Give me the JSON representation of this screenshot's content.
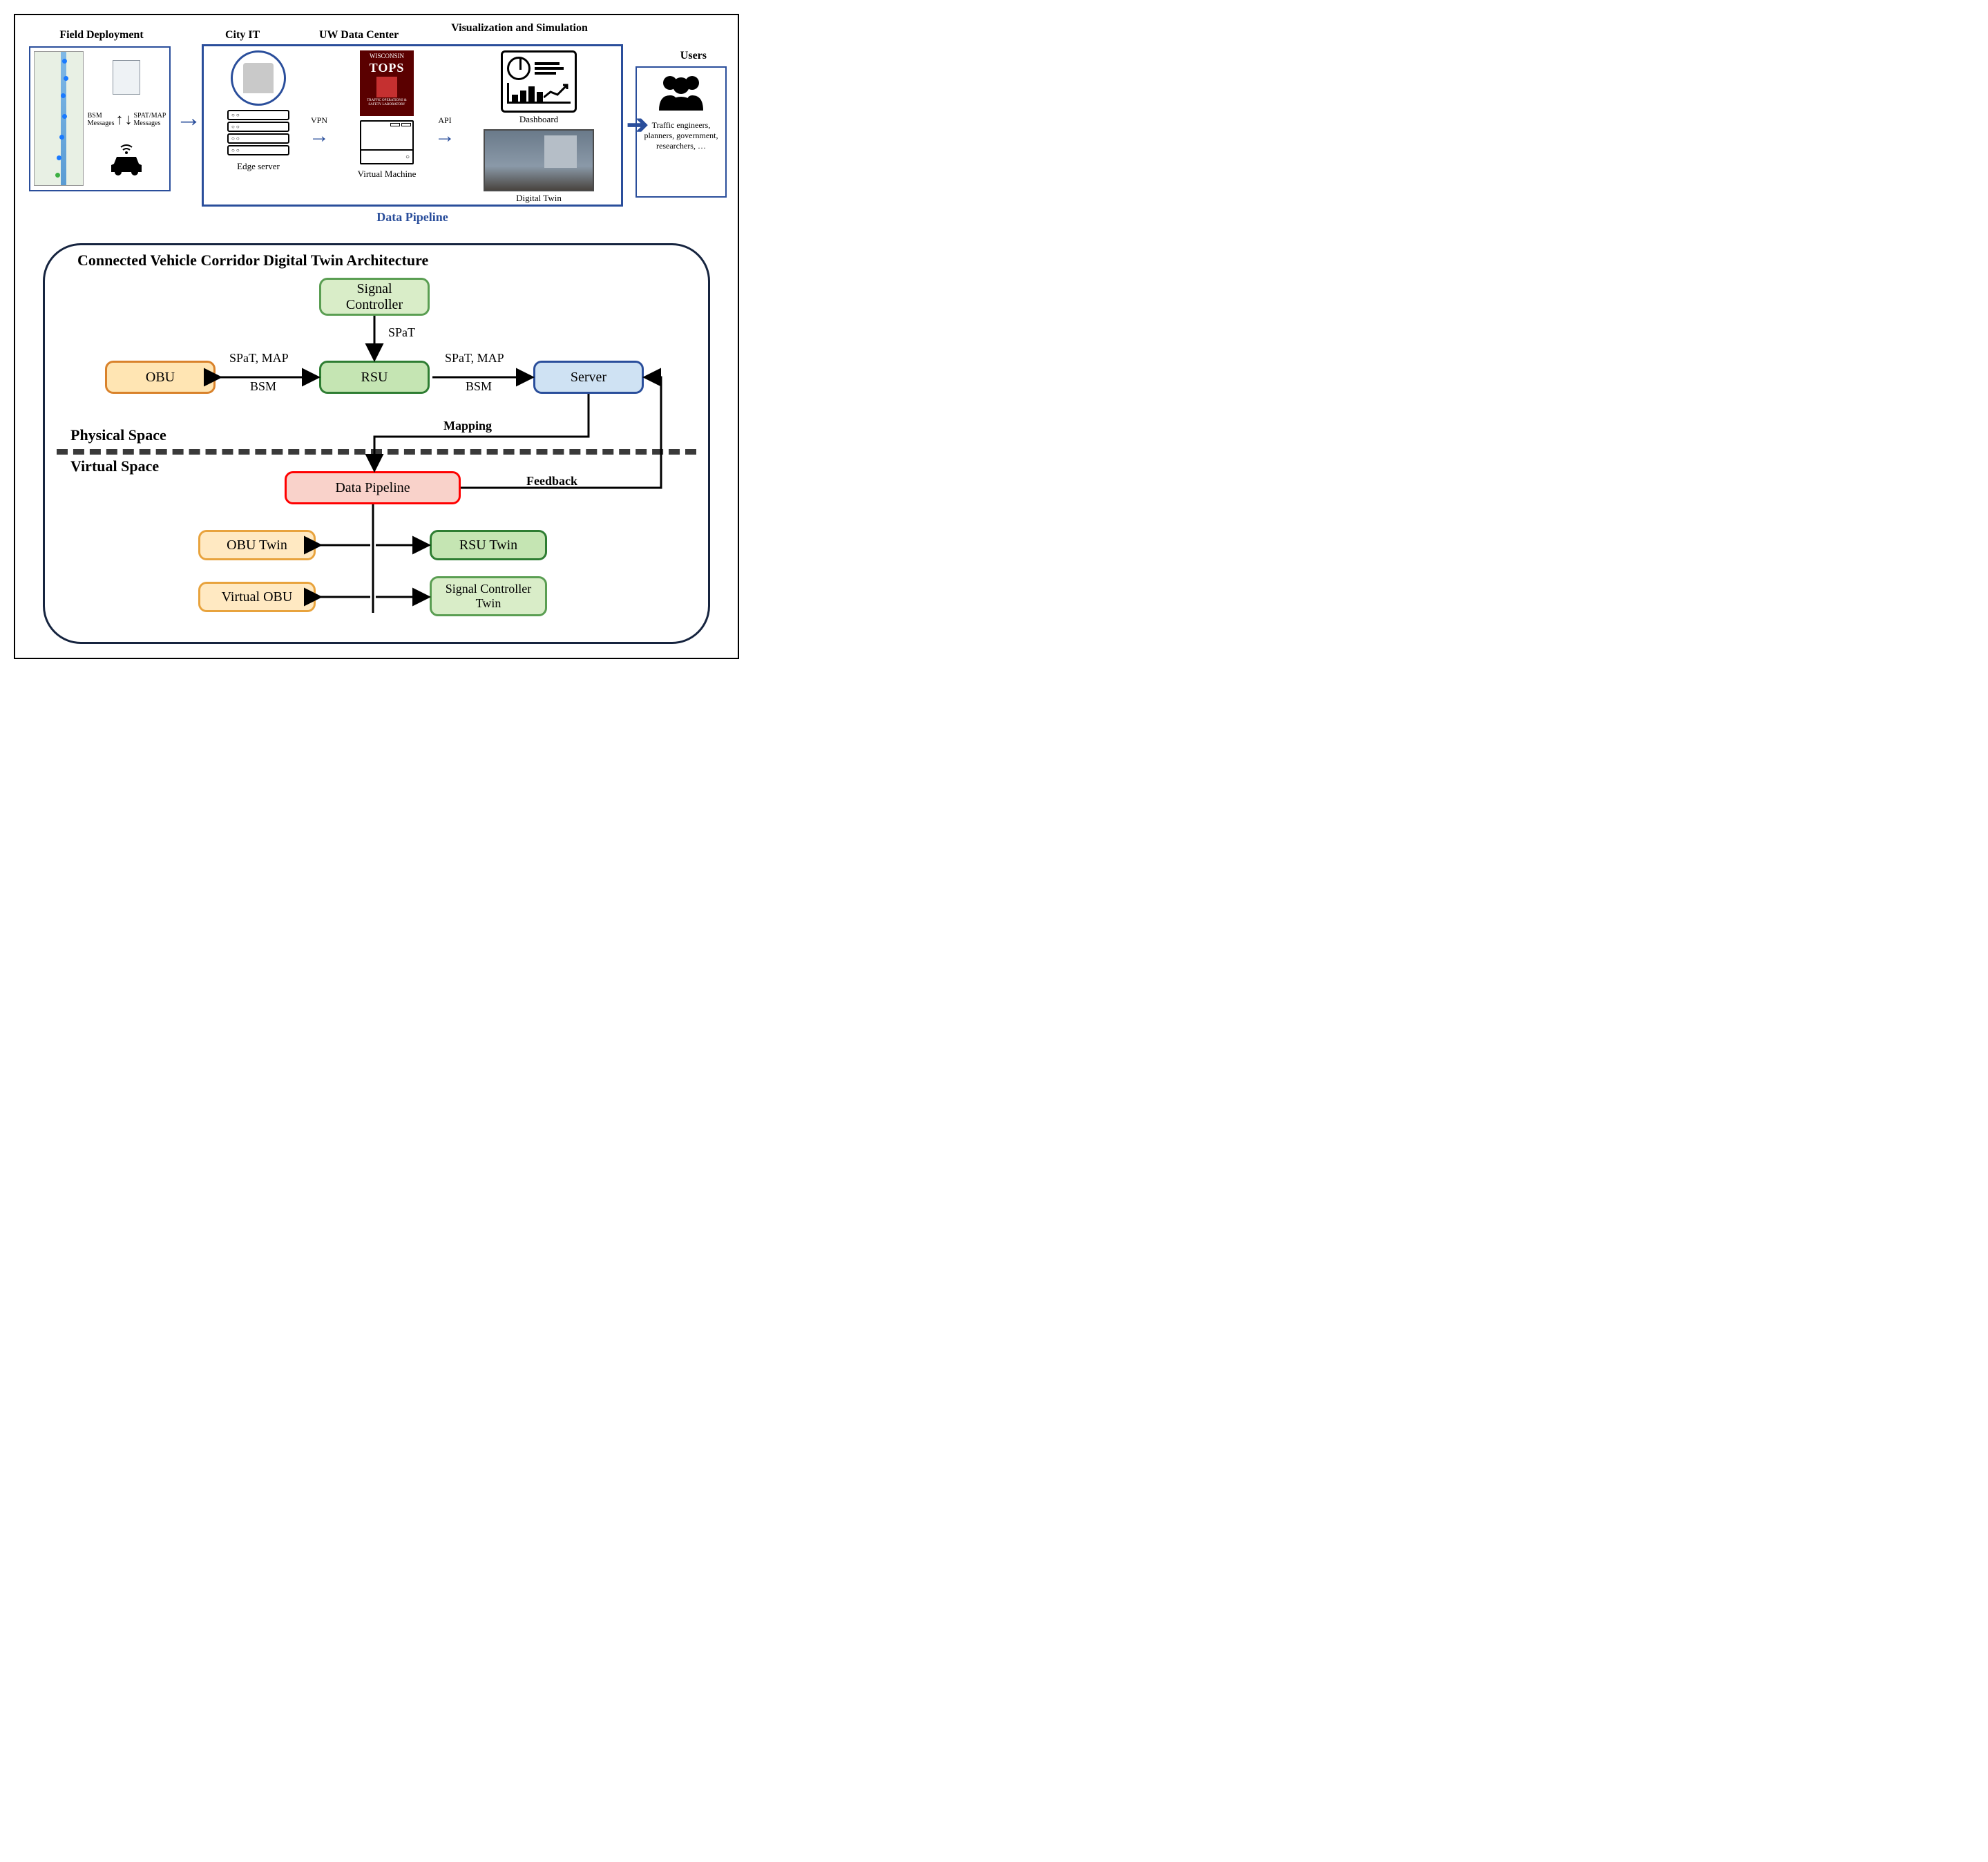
{
  "top": {
    "titles": {
      "field": "Field Deployment",
      "city": "City IT",
      "uw": "UW Data Center",
      "viz": "Visualization and Simulation",
      "users": "Users"
    },
    "field": {
      "bsm": "BSM Messages",
      "spat": "SPAT/MAP Messages"
    },
    "city": {
      "edge": "Edge server"
    },
    "uw": {
      "tops_top": "WISCONSIN",
      "tops": "TOPS",
      "tops_sub": "TRAFFIC OPERATIONS & SAFETY LABORATORY",
      "vm": "Virtual Machine"
    },
    "viz": {
      "dash": "Dashboard",
      "twin": "Digital Twin"
    },
    "arr": {
      "vpn": "VPN",
      "api": "API"
    },
    "pipeline": "Data Pipeline",
    "users": "Traffic engineers, planners, government, researchers, …"
  },
  "bottom": {
    "title": "Connected Vehicle Corridor Digital Twin Architecture",
    "nodes": {
      "sig": "Signal Controller",
      "obu": "OBU",
      "rsu": "RSU",
      "server": "Server",
      "dp": "Data Pipeline",
      "obut": "OBU Twin",
      "rsut": "RSU Twin",
      "vobu": "Virtual OBU",
      "sigt": "Signal Controller Twin"
    },
    "edges": {
      "spat": "SPaT",
      "sm1": "SPaT, MAP",
      "bsm": "BSM",
      "sm2": "SPaT, MAP",
      "mapping": "Mapping",
      "feedback": "Feedback"
    },
    "spaces": {
      "phys": "Physical Space",
      "virt": "Virtual Space"
    }
  }
}
